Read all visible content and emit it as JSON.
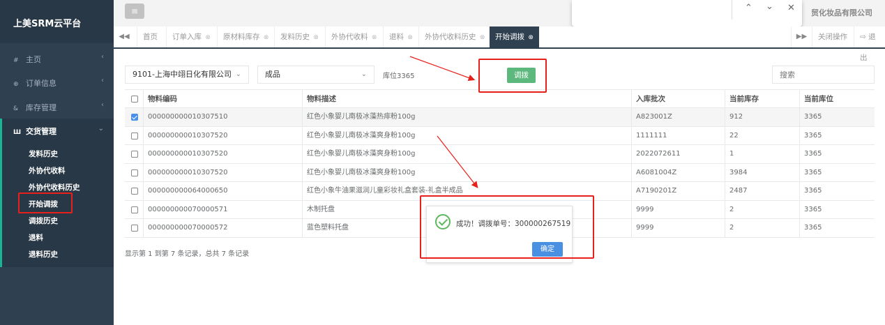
{
  "app": {
    "title": "上美SRM云平台"
  },
  "header": {
    "company_tail": "贸化妆品有限公司",
    "menu_icon": "≡"
  },
  "findbar": {
    "up": "⌃",
    "down": "⌄",
    "close": "✕"
  },
  "sidebar": {
    "items": [
      {
        "icon": "#",
        "label": "主页"
      },
      {
        "icon": "⊕",
        "label": "订单信息"
      },
      {
        "icon": "&",
        "label": "库存管理"
      },
      {
        "icon": "Ш",
        "label": "交货管理"
      }
    ],
    "caret_left": "‹",
    "caret_down": "⌄",
    "submenu": [
      "发料历史",
      "外协代收料",
      "外协代收料历史",
      "开始调拨",
      "调拨历史",
      "退料",
      "退料历史"
    ]
  },
  "tabs": {
    "prev": "◀◀",
    "next": "▶▶",
    "items": [
      {
        "label": "首页",
        "closable": ""
      },
      {
        "label": "订单入库",
        "closable": "⊗"
      },
      {
        "label": "原材料库存",
        "closable": "⊗"
      },
      {
        "label": "发料历史",
        "closable": "⊗"
      },
      {
        "label": "外协代收料",
        "closable": "⊗"
      },
      {
        "label": "退料",
        "closable": "⊗"
      },
      {
        "label": "外协代收料历史",
        "closable": "⊗"
      },
      {
        "label": "开始调拨",
        "closable": "⊗"
      }
    ],
    "close_ops": "关闭操作",
    "logout": "⇨ 退出"
  },
  "filters": {
    "company": "9101-上海中翊日化有限公司",
    "category": "成品",
    "location": "库位3365",
    "chevron": "⌄",
    "transfer_button": "调拨",
    "search_placeholder": "搜索"
  },
  "table": {
    "headers": [
      "物料编码",
      "物料描述",
      "入库批次",
      "当前库存",
      "当前库位"
    ],
    "rows": [
      {
        "code": "000000000010307510",
        "desc": "红色小象婴儿南极冰藻热痱粉100g",
        "batch": "A823001Z",
        "stock": "912",
        "loc": "3365",
        "checked": true
      },
      {
        "code": "000000000010307520",
        "desc": "红色小象婴儿南极冰藻爽身粉100g",
        "batch": "1111111",
        "stock": "22",
        "loc": "3365",
        "checked": false
      },
      {
        "code": "000000000010307520",
        "desc": "红色小象婴儿南极冰藻爽身粉100g",
        "batch": "2022072611",
        "stock": "1",
        "loc": "3365",
        "checked": false
      },
      {
        "code": "000000000010307520",
        "desc": "红色小象婴儿南极冰藻爽身粉100g",
        "batch": "A6081004Z",
        "stock": "3984",
        "loc": "3365",
        "checked": false
      },
      {
        "code": "000000000064000650",
        "desc": "红色小象牛油果滋润儿童彩妆礼盒套装-礼盒半成品",
        "batch": "A7190201Z",
        "stock": "2487",
        "loc": "3365",
        "checked": false
      },
      {
        "code": "000000000070000571",
        "desc": "木制托盘",
        "batch": "9999",
        "stock": "2",
        "loc": "3365",
        "checked": false
      },
      {
        "code": "000000000070000572",
        "desc": "蓝色塑料托盘",
        "batch": "9999",
        "stock": "2",
        "loc": "3365",
        "checked": false
      }
    ],
    "footer": "显示第 1 到第 7 条记录，总共 7 条记录"
  },
  "dialog": {
    "message": "成功！调拨单号：300000267519",
    "ok": "确定"
  },
  "colors": {
    "sidebar": "#2f4050",
    "accent": "#1ab394",
    "transfer_btn": "#5cb87c",
    "ok_btn": "#4a90e2",
    "annotation": "#e8201c"
  }
}
